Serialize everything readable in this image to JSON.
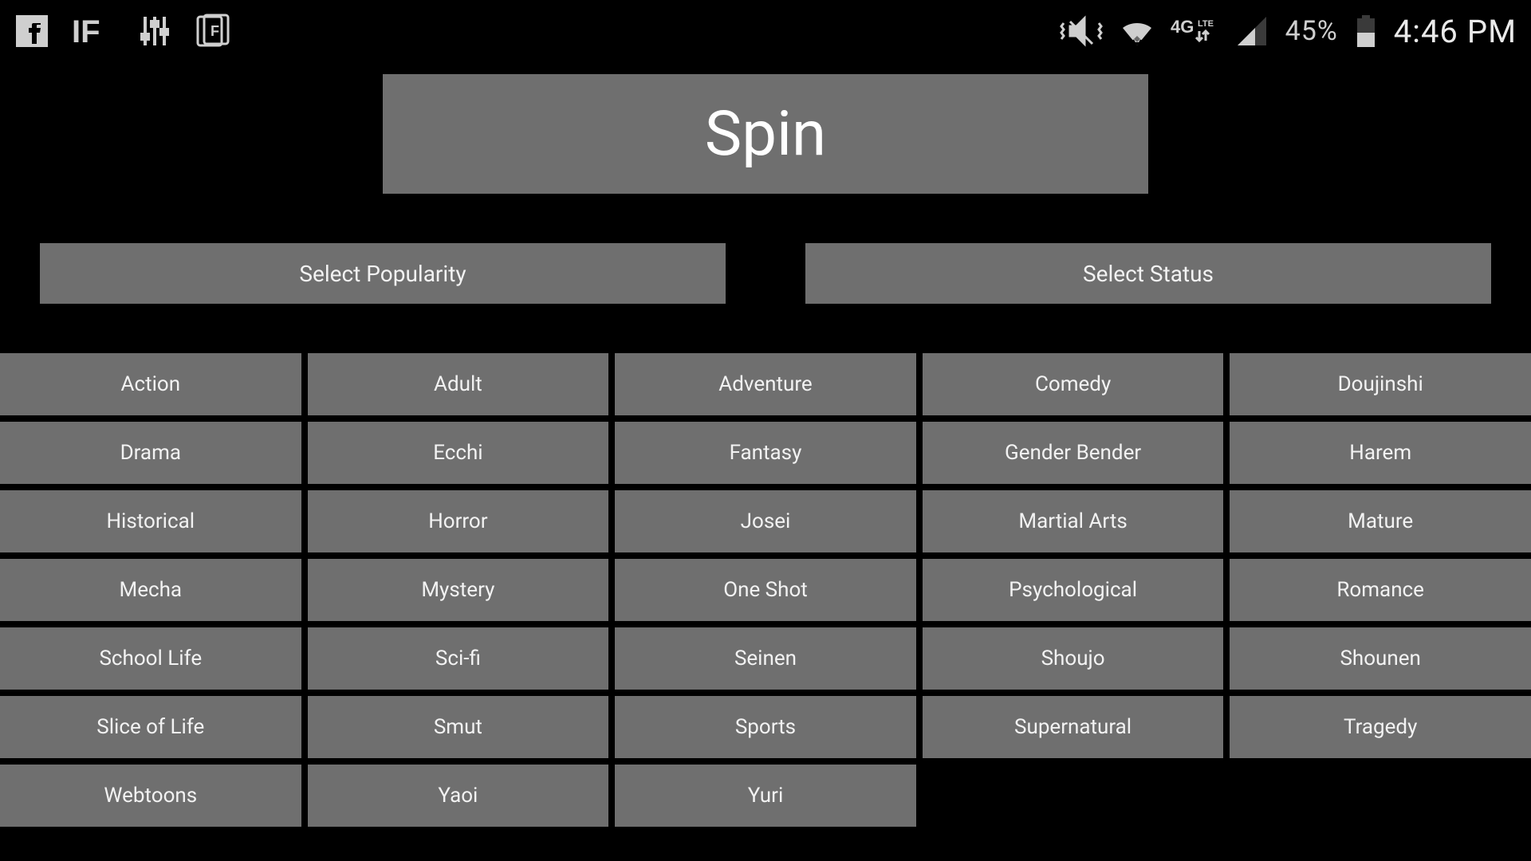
{
  "status_bar": {
    "battery_percent": "45%",
    "clock": "4:46 PM",
    "network_label": "4G LTE"
  },
  "spin_label": "Spin",
  "select_popularity_label": "Select Popularity",
  "select_status_label": "Select Status",
  "genres": [
    "Action",
    "Adult",
    "Adventure",
    "Comedy",
    "Doujinshi",
    "Drama",
    "Ecchi",
    "Fantasy",
    "Gender Bender",
    "Harem",
    "Historical",
    "Horror",
    "Josei",
    "Martial Arts",
    "Mature",
    "Mecha",
    "Mystery",
    "One Shot",
    "Psychological",
    "Romance",
    "School Life",
    "Sci-fi",
    "Seinen",
    "Shoujo",
    "Shounen",
    "Slice of Life",
    "Smut",
    "Sports",
    "Supernatural",
    "Tragedy",
    "Webtoons",
    "Yaoi",
    "Yuri"
  ]
}
